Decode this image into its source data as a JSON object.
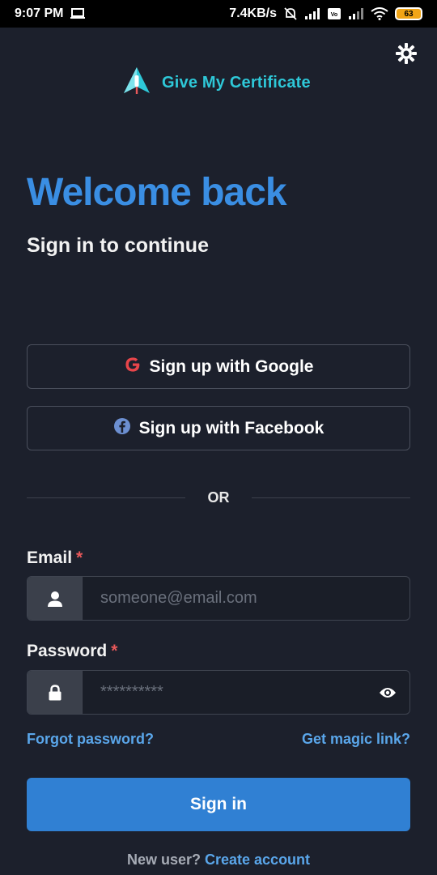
{
  "status_bar": {
    "time": "9:07 PM",
    "speed": "7.4KB/s",
    "battery": "63",
    "icons": [
      "laptop-icon",
      "mute-alarm-icon",
      "signal-icon",
      "volte-icon",
      "signal-icon-2",
      "wifi-icon",
      "battery-icon"
    ]
  },
  "brand": {
    "name": "Give My Certificate",
    "logo_icon": "rocket-icon"
  },
  "header": {
    "title": "Welcome back",
    "subtitle": "Sign in to continue",
    "title_color": "#3a8ee3"
  },
  "social": {
    "google_label": "Sign up with Google",
    "facebook_label": "Sign up with Facebook"
  },
  "divider": {
    "text": "OR"
  },
  "form": {
    "email_label": "Email",
    "email_placeholder": "someone@email.com",
    "password_label": "Password",
    "password_placeholder": "**********",
    "required_mark": "*",
    "forgot_label": "Forgot password?",
    "magic_label": "Get magic link?",
    "submit_label": "Sign in"
  },
  "footer": {
    "prompt": "New user?",
    "create_label": "Create account"
  },
  "colors": {
    "background": "#1c202c",
    "accent": "#3080d3",
    "brand": "#2ec8d8",
    "link": "#5aa6ea",
    "required": "#e8585a"
  }
}
